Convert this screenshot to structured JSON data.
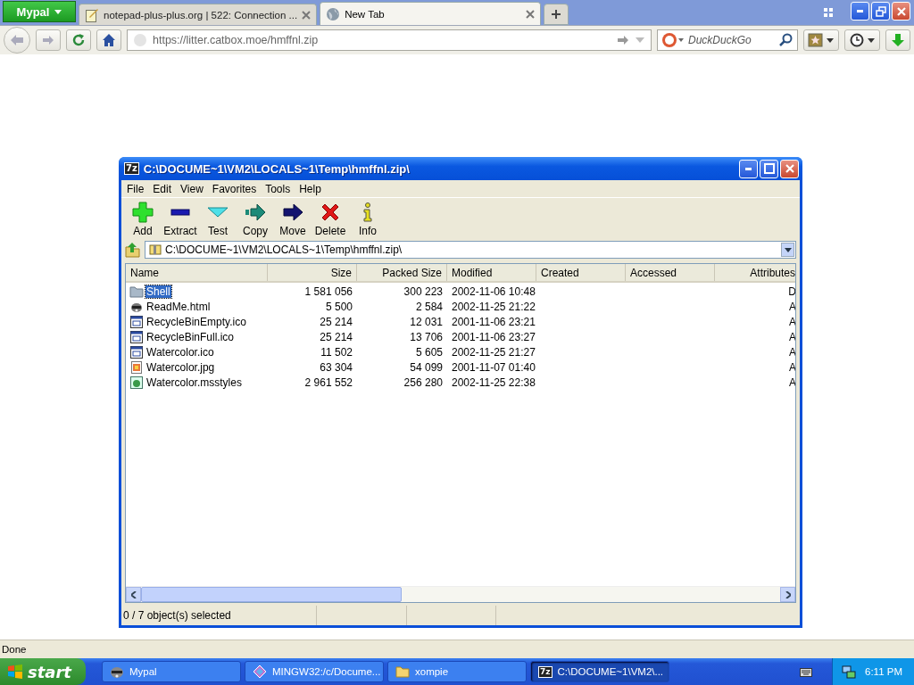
{
  "browser": {
    "menu_button": "Mypal",
    "tabs": [
      {
        "title": "notepad-plus-plus.org | 522: Connection ...",
        "kind": "document",
        "selected": false
      },
      {
        "title": "New Tab",
        "kind": "globe",
        "selected": true
      }
    ],
    "address": "https://litter.catbox.moe/hmffnl.zip",
    "search": {
      "placeholder": "DuckDuckGo"
    },
    "status": "Done"
  },
  "archive_window": {
    "icon_text": "7z",
    "title": "C:\\DOCUME~1\\VM2\\LOCALS~1\\Temp\\hmffnl.zip\\",
    "menu": [
      "File",
      "Edit",
      "View",
      "Favorites",
      "Tools",
      "Help"
    ],
    "toolbar": [
      {
        "label": "Add",
        "kind": "add"
      },
      {
        "label": "Extract",
        "kind": "extract"
      },
      {
        "label": "Test",
        "kind": "test"
      },
      {
        "label": "Copy",
        "kind": "copy"
      },
      {
        "label": "Move",
        "kind": "move"
      },
      {
        "label": "Delete",
        "kind": "delete"
      },
      {
        "label": "Info",
        "kind": "info"
      }
    ],
    "path": "C:\\DOCUME~1\\VM2\\LOCALS~1\\Temp\\hmffnl.zip\\",
    "table": {
      "columns": [
        "Name",
        "Size",
        "Packed Size",
        "Modified",
        "Created",
        "Accessed",
        "Attributes"
      ],
      "rows": [
        {
          "kind": "folder",
          "selected": true,
          "cells": [
            "Shell",
            "1 581 056",
            "300 223",
            "2002-11-06 10:48",
            "",
            "",
            "D"
          ]
        },
        {
          "kind": "html",
          "selected": false,
          "cells": [
            "ReadMe.html",
            "5 500",
            "2 584",
            "2002-11-25 21:22",
            "",
            "",
            "A"
          ]
        },
        {
          "kind": "ico",
          "selected": false,
          "cells": [
            "RecycleBinEmpty.ico",
            "25 214",
            "12 031",
            "2001-11-06 23:21",
            "",
            "",
            "A"
          ]
        },
        {
          "kind": "ico",
          "selected": false,
          "cells": [
            "RecycleBinFull.ico",
            "25 214",
            "13 706",
            "2001-11-06 23:27",
            "",
            "",
            "A"
          ]
        },
        {
          "kind": "ico",
          "selected": false,
          "cells": [
            "Watercolor.ico",
            "11 502",
            "5 605",
            "2002-11-25 21:27",
            "",
            "",
            "A"
          ]
        },
        {
          "kind": "jpg",
          "selected": false,
          "cells": [
            "Watercolor.jpg",
            "63 304",
            "54 099",
            "2001-11-07 01:40",
            "",
            "",
            "A"
          ]
        },
        {
          "kind": "msstyles",
          "selected": false,
          "cells": [
            "Watercolor.msstyles",
            "2 961 552",
            "256 280",
            "2002-11-25 22:38",
            "",
            "",
            "A"
          ]
        }
      ]
    },
    "status": "0 / 7 object(s) selected"
  },
  "taskbar": {
    "start": "start",
    "items": [
      {
        "label": "Mypal",
        "kind": "raccoon",
        "selected": false
      },
      {
        "label": "MINGW32:/c/Docume...",
        "kind": "diamond",
        "selected": false
      },
      {
        "label": "xompie",
        "kind": "folder",
        "selected": false
      },
      {
        "label": "C:\\DOCUME~1\\VM2\\...",
        "kind": "sevenzip",
        "icon_text": "7z",
        "selected": true
      }
    ],
    "clock": "6:11 PM"
  }
}
